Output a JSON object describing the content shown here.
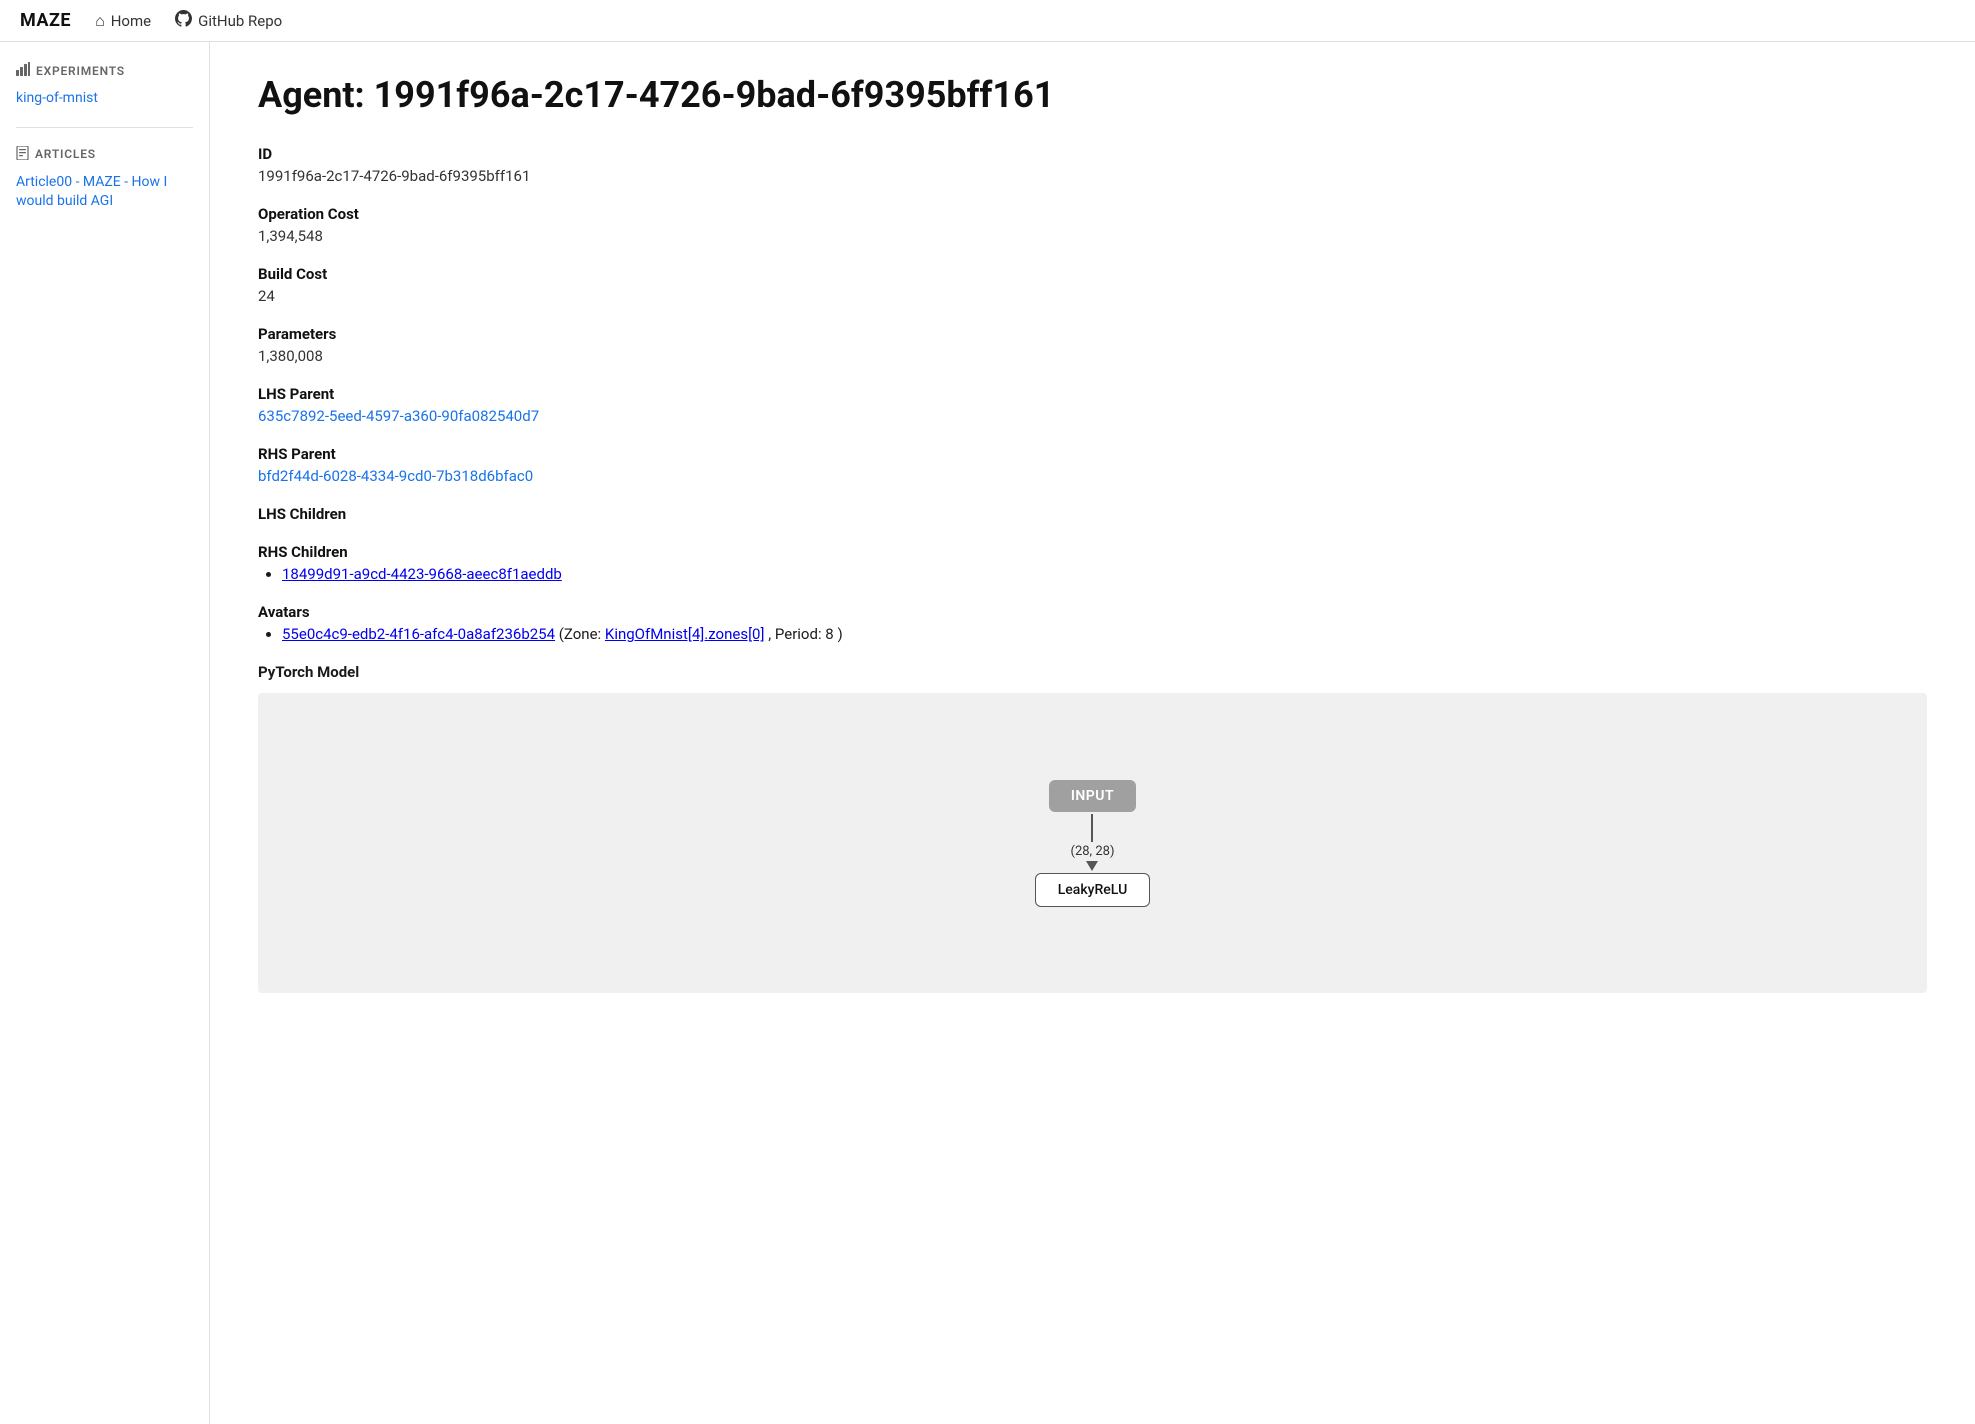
{
  "nav": {
    "brand": "MAZE",
    "home_label": "Home",
    "github_label": "GitHub Repo"
  },
  "sidebar": {
    "experiments_section": "EXPERIMENTS",
    "experiments_items": [
      {
        "label": "king-of-mnist",
        "href": "#"
      }
    ],
    "articles_section": "ARTICLES",
    "articles_items": [
      {
        "label": "Article00 - MAZE - How I would build AGI",
        "href": "#"
      }
    ]
  },
  "agent": {
    "title_prefix": "Agent:",
    "id_value": "1991f96a-2c17-4726-9bad-6f9395bff161",
    "id_label": "ID",
    "operation_cost_label": "Operation Cost",
    "operation_cost_value": "1,394,548",
    "build_cost_label": "Build Cost",
    "build_cost_value": "24",
    "parameters_label": "Parameters",
    "parameters_value": "1,380,008",
    "lhs_parent_label": "LHS Parent",
    "lhs_parent_value": "635c7892-5eed-4597-a360-90fa082540d7",
    "rhs_parent_label": "RHS Parent",
    "rhs_parent_value": "bfd2f44d-6028-4334-9cd0-7b318d6bfac0",
    "lhs_children_label": "LHS Children",
    "lhs_children_items": [],
    "rhs_children_label": "RHS Children",
    "rhs_children_items": [
      {
        "label": "18499d91-a9cd-4423-9668-aeec8f1aeddb",
        "href": "#"
      }
    ],
    "avatars_label": "Avatars",
    "avatars_items": [
      {
        "link_label": "55e0c4c9-edb2-4f16-afc4-0a8af236b254",
        "href": "#",
        "zone_label": "Zone:",
        "zone_value": "KingOfMnist[4].zones[0]",
        "period_label": "Period:",
        "period_value": "8"
      }
    ],
    "pytorch_model_label": "PyTorch Model",
    "diagram": {
      "input_label": "INPUT",
      "arrow_label": "(28, 28)",
      "layer_label": "LeakyReLU"
    }
  }
}
